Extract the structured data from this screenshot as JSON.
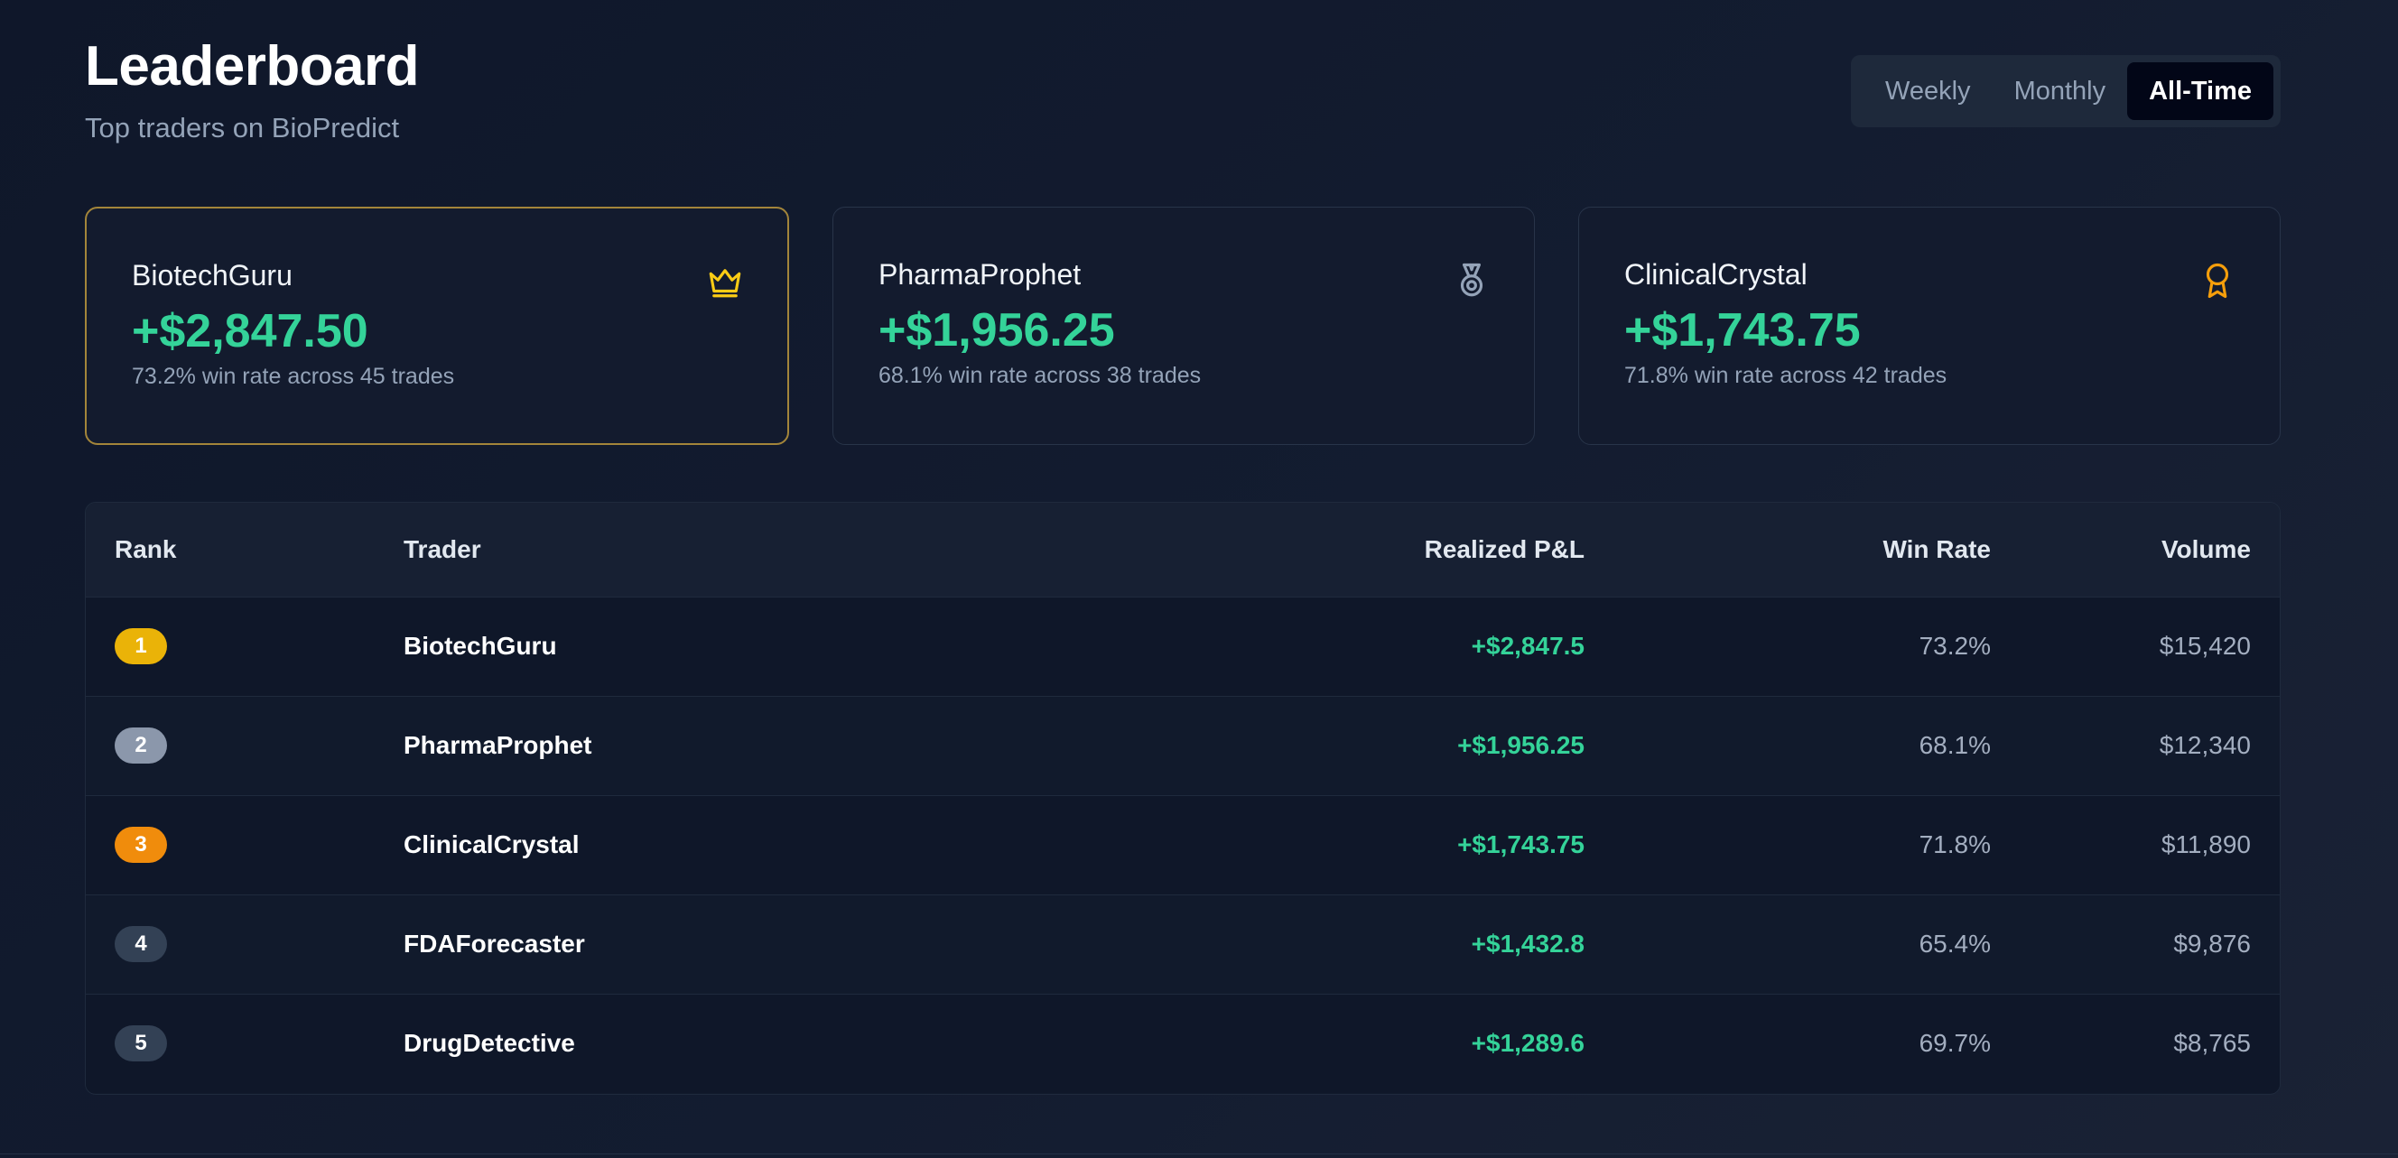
{
  "header": {
    "title": "Leaderboard",
    "subtitle": "Top traders on BioPredict"
  },
  "periods": {
    "weekly": "Weekly",
    "monthly": "Monthly",
    "all_time": "All-Time",
    "selected": "All-Time"
  },
  "top_cards": [
    {
      "name": "BiotechGuru",
      "pnl": "+$2,847.50",
      "stats": "73.2% win rate across 45 trades",
      "icon": "crown-icon"
    },
    {
      "name": "PharmaProphet",
      "pnl": "+$1,956.25",
      "stats": "68.1% win rate across 38 trades",
      "icon": "medal-icon"
    },
    {
      "name": "ClinicalCrystal",
      "pnl": "+$1,743.75",
      "stats": "71.8% win rate across 42 trades",
      "icon": "award-icon"
    }
  ],
  "table": {
    "headers": {
      "rank": "Rank",
      "trader": "Trader",
      "pnl": "Realized P&L",
      "win_rate": "Win Rate",
      "volume": "Volume"
    },
    "rows": [
      {
        "rank": "1",
        "trader": "BiotechGuru",
        "pnl": "+$2,847.5",
        "win_rate": "73.2%",
        "volume": "$15,420"
      },
      {
        "rank": "2",
        "trader": "PharmaProphet",
        "pnl": "+$1,956.25",
        "win_rate": "68.1%",
        "volume": "$12,340"
      },
      {
        "rank": "3",
        "trader": "ClinicalCrystal",
        "pnl": "+$1,743.75",
        "win_rate": "71.8%",
        "volume": "$11,890"
      },
      {
        "rank": "4",
        "trader": "FDAForecaster",
        "pnl": "+$1,432.8",
        "win_rate": "65.4%",
        "volume": "$9,876"
      },
      {
        "rank": "5",
        "trader": "DrugDetective",
        "pnl": "+$1,289.6",
        "win_rate": "69.7%",
        "volume": "$8,765"
      }
    ]
  },
  "colors": {
    "accent_green": "#34d399",
    "gold": "#eab308",
    "silver": "#8b97ab",
    "bronze": "#f08c0c",
    "default_badge": "#334155",
    "crown": "#facc15",
    "medal": "#94a3b8",
    "award": "#f59e0b",
    "first_card_border": "#a3853a"
  }
}
